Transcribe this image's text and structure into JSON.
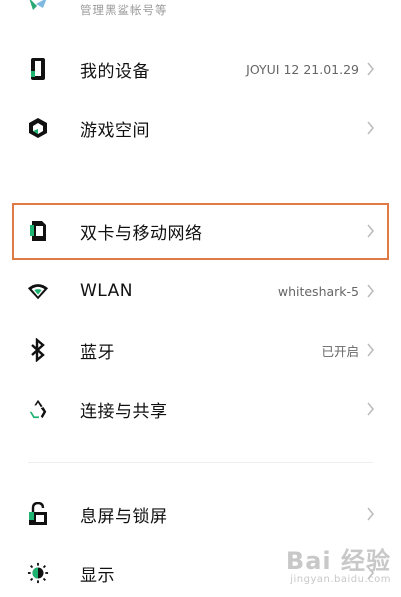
{
  "account": {
    "subtitle": "管理黑鲨帐号等"
  },
  "items": [
    {
      "label": "我的设备",
      "value": "JOYUI 12 21.01.29",
      "icon": "phone-icon"
    },
    {
      "label": "游戏空间",
      "value": "",
      "icon": "game-space-icon"
    },
    {
      "label": "双卡与移动网络",
      "value": "",
      "icon": "sim-card-icon"
    },
    {
      "label": "WLAN",
      "value": "whiteshark-5",
      "icon": "wifi-icon"
    },
    {
      "label": "蓝牙",
      "value": "已开启",
      "icon": "bluetooth-icon"
    },
    {
      "label": "连接与共享",
      "value": "",
      "icon": "share-icon"
    },
    {
      "label": "息屏与锁屏",
      "value": "",
      "icon": "lock-icon"
    },
    {
      "label": "显示",
      "value": "",
      "icon": "brightness-icon"
    }
  ],
  "colors": {
    "accent": "#1db370",
    "highlight_border": "#e07a45"
  },
  "watermark": {
    "main": "Bai 经验",
    "sub": "jingyan.baidu.com"
  }
}
